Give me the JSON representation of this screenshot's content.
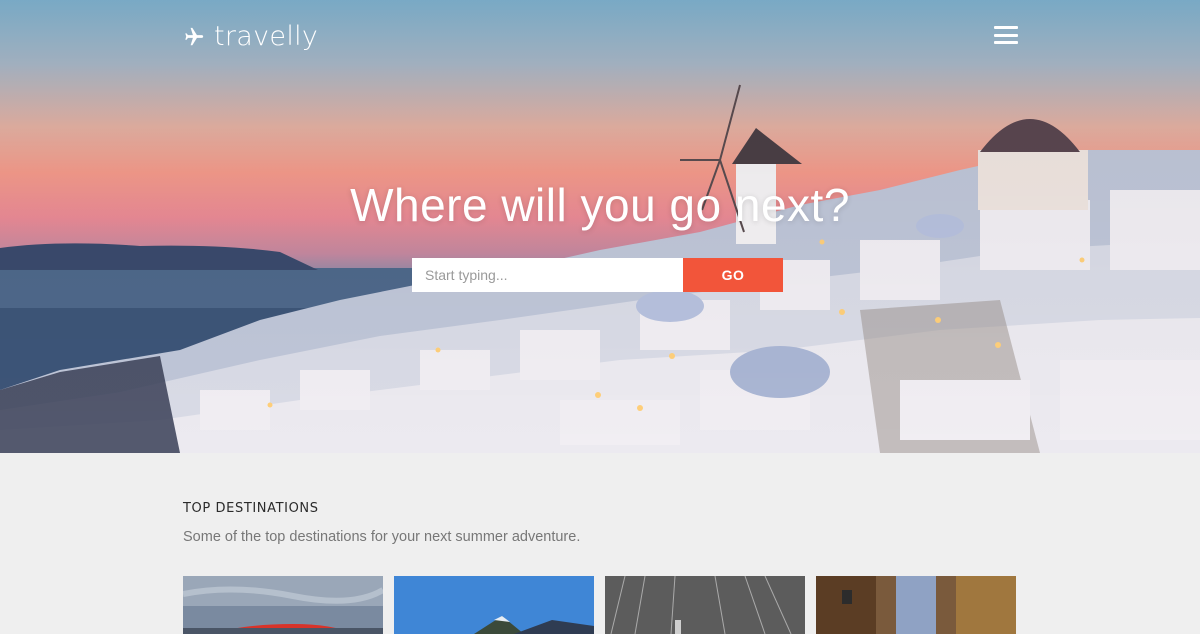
{
  "header": {
    "brand": "travelly",
    "logo_icon": "airplane-icon",
    "menu_icon": "hamburger-menu-icon"
  },
  "hero": {
    "headline": "Where will you go next?",
    "search": {
      "placeholder": "Start typing...",
      "value": "",
      "button_label": "GO"
    }
  },
  "destinations": {
    "title": "TOP DESTINATIONS",
    "subtitle": "Some of the top destinations for your next summer adventure.",
    "cards": [
      {
        "name": "destination-card-1"
      },
      {
        "name": "destination-card-2"
      },
      {
        "name": "destination-card-3"
      },
      {
        "name": "destination-card-4"
      }
    ]
  },
  "colors": {
    "accent": "#f2553a",
    "background": "#efefef",
    "heading_text": "#2b2b2b",
    "muted_text": "#777777"
  }
}
